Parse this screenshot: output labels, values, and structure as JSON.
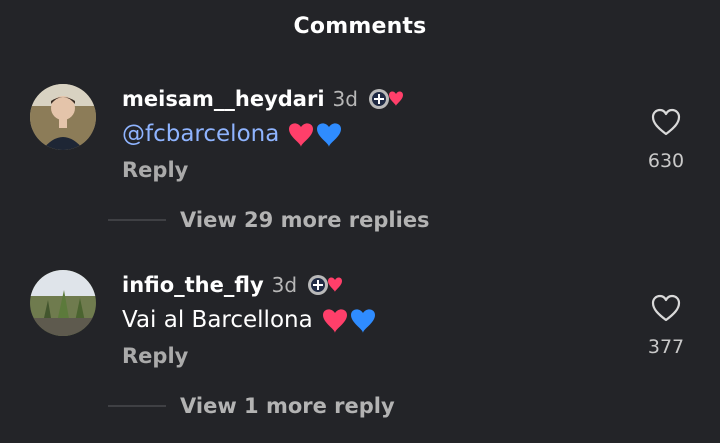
{
  "header": {
    "title": "Comments"
  },
  "comments": [
    {
      "username": "meisam__heydari",
      "time": "3d",
      "mention": "@fcbarcelona",
      "text": "",
      "reply_label": "Reply",
      "likes": "630",
      "view_replies": "View 29 more replies",
      "emoji": [
        "heart-red",
        "heart-blue"
      ],
      "badge_icon": "club-badge-heart"
    },
    {
      "username": "infio_the_fly",
      "time": "3d",
      "mention": "",
      "text": "Vai al Barcellona",
      "reply_label": "Reply",
      "likes": "377",
      "view_replies": "View 1 more reply",
      "emoji": [
        "heart-red",
        "heart-blue"
      ],
      "badge_icon": "club-badge-heart"
    }
  ],
  "colors": {
    "background": "#232428",
    "mention": "#8fb4ff",
    "secondary_text": "#b7b7b7",
    "heart_red": "#ff3f6a",
    "heart_blue": "#2f8cff"
  }
}
